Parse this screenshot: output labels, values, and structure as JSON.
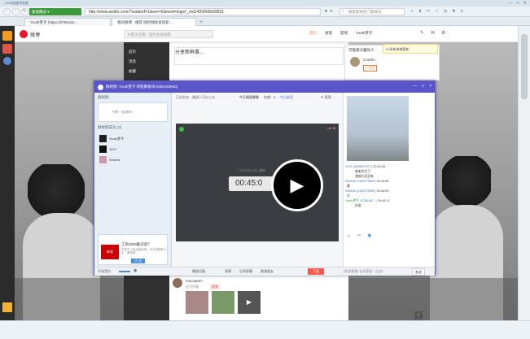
{
  "browser": {
    "title": "2345加速浏览器",
    "url": "http://www.weibo.com/?sudaref=1&wvr=6&mod=logo#_rnd1429965699551",
    "search_placeholder": "搜索新闻热门新闻词",
    "tabs": [
      {
        "label": "Youth梦子 (https://2766192...",
        "active": false
      },
      {
        "label": "我的微博 - 推荐 随时随地发现新...",
        "active": true
      }
    ]
  },
  "weibo": {
    "logo": "微博",
    "search_placeholder": "大家正在搜：国外女孩失踪",
    "nav": [
      "首页",
      "发现",
      "游戏",
      "Youth梦子"
    ],
    "left_menu": [
      "首页",
      "消息",
      "收藏"
    ],
    "post_placeholder": "分享新鲜事...",
    "popup_title": "可能感兴趣的人",
    "popup_user": "Comfro",
    "popup_follow": "+ 关注",
    "popup_note": "52条新微博更新",
    "friend_name": "mucoqmin",
    "friend_post": "近日外看",
    "video_tag": "视频"
  },
  "chat": {
    "title": "群视频: Youth梦子 的轻聊板块(1992184840)",
    "left_header": "群视频",
    "left_desc": "今晚 一起嗨吗",
    "members_header": "群视频成员 (3)",
    "members": [
      "Youth梦子",
      "1974",
      "Shirene"
    ],
    "ad_title": "工资3000能买房？",
    "ad_desc": "不用不上班也能买房，可实现轻松人生，原来就...",
    "ad_button": "点 击",
    "status_line": "正在发言：邀请人可以上台",
    "mode_label": "今天随便聊聊",
    "online_count": "在线：3",
    "center_link": "今日会話",
    "timer": "00:45:0",
    "overlay_text": "点击可以进入播放",
    "host_badge": "4",
    "viewer_badge": "0",
    "messages": [
      {
        "name": "1974",
        "id": "(4039627577)",
        "time": "20:42:49",
        "text": "感谢关注了"
      },
      {
        "name": "1974",
        "id": "",
        "time": "",
        "text": "我咱什还没有"
      },
      {
        "name": "Shirene",
        "id": "(1182075600)",
        "time": "20:44:09",
        "text": "嗯"
      },
      {
        "name": "Shirene",
        "id": "(1182075600)",
        "time": "20:44:09",
        "text": "😊"
      },
      {
        "name": "Youth梦子",
        "id": "(2766192...)",
        "time": "20:44:12",
        "text": "好诶"
      }
    ],
    "bottom_left": "开场音乐",
    "bottom_center": [
      "表情",
      "分享屏幕",
      "邀请朋友"
    ],
    "bottom_settings": "播放设备",
    "bottom_red": "下麦",
    "bottom_right_text": "[发送视频] 论文家画（点击）",
    "send": "发送",
    "close": "×"
  }
}
